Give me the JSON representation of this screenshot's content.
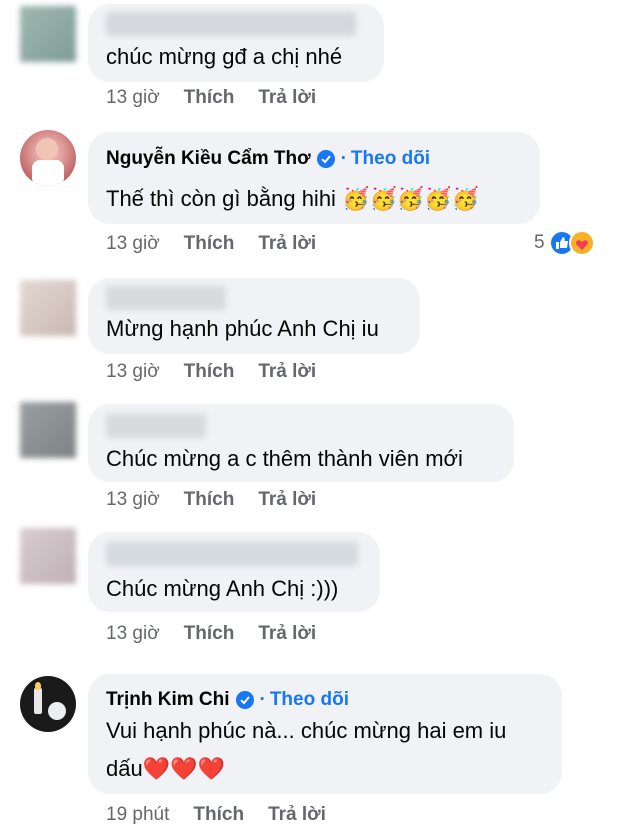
{
  "comments": [
    {
      "author": "",
      "text": "chúc mừng gđ a chị nhé",
      "time": "13 giờ",
      "like_label": "Thích",
      "reply_label": "Trả lời"
    },
    {
      "author": "Nguyễn Kiều Cẩm Thơ",
      "follow_label": "Theo dõi",
      "text": "Thế thì còn gì bằng hihi 🥳🥳🥳🥳🥳",
      "time": "13 giờ",
      "like_label": "Thích",
      "reply_label": "Trả lời",
      "reaction_count": "5"
    },
    {
      "author": "",
      "text": "Mừng hạnh phúc Anh Chị iu",
      "time": "13 giờ",
      "like_label": "Thích",
      "reply_label": "Trả lời"
    },
    {
      "author": "",
      "text": "Chúc mừng a c thêm thành viên mới",
      "time": "13 giờ",
      "like_label": "Thích",
      "reply_label": "Trả lời"
    },
    {
      "author": "",
      "text": "Chúc mừng Anh Chị :)))",
      "time": "13 giờ",
      "like_label": "Thích",
      "reply_label": "Trả lời"
    },
    {
      "author": "Trịnh Kim Chi",
      "follow_label": "Theo dõi",
      "text_line1": "Vui hạnh phúc nà... chúc mừng hai em iu",
      "text_line2": "dấu❤️❤️❤️",
      "time": "19 phút",
      "like_label": "Thích",
      "reply_label": "Trả lời"
    }
  ],
  "colors": {
    "bubble": "#f0f2f5",
    "link": "#1877f2",
    "meta": "#65676b"
  },
  "icons": {
    "verified": "verified-badge-icon",
    "like_reaction": "like-reaction-icon",
    "care_reaction": "care-reaction-icon"
  }
}
